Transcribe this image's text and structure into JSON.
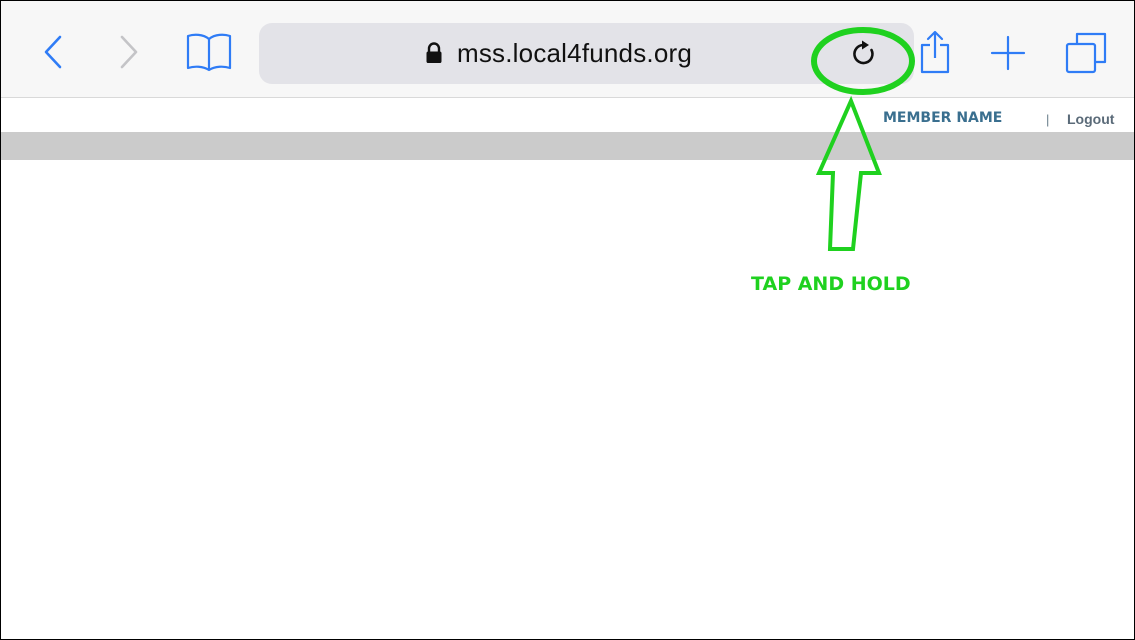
{
  "browser": {
    "url": "mss.local4funds.org",
    "icons": {
      "back": "chevron-left-icon",
      "forward": "chevron-right-icon",
      "bookmarks": "book-icon",
      "lock": "lock-icon",
      "reload": "reload-icon",
      "share": "share-icon",
      "new_tab": "plus-icon",
      "tabs": "tabs-icon"
    },
    "accent_color": "#2f7cf6"
  },
  "page": {
    "member_name": "MEMBER NAME",
    "separator": "|",
    "logout_label": "Logout"
  },
  "annotation": {
    "label": "TAP AND HOLD",
    "color": "#1fd11f"
  }
}
